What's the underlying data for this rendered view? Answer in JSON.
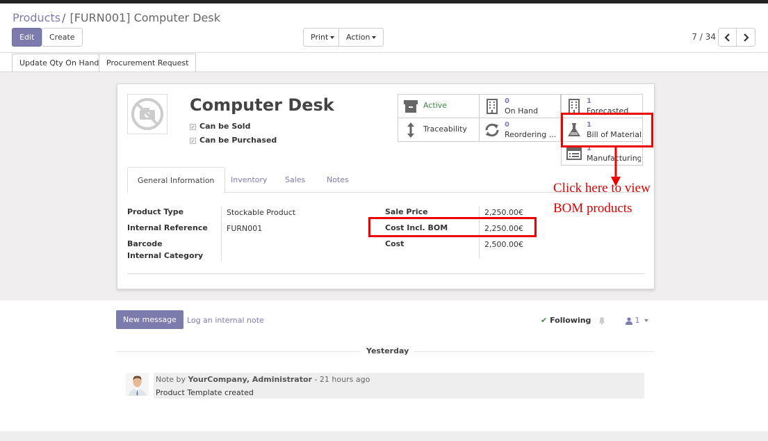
{
  "breadcrumb": {
    "parent": "Products",
    "separator": "/",
    "current": "[FURN001] Computer Desk"
  },
  "toolbar": {
    "edit": "Edit",
    "create": "Create",
    "print": "Print",
    "action": "Action"
  },
  "pager": {
    "value": "7 / 34"
  },
  "statusbar": {
    "update_qty": "Update Qty On Hand",
    "procurement": "Procurement Request"
  },
  "product": {
    "name": "Computer Desk",
    "can_be_sold": "Can be Sold",
    "can_be_purchased": "Can be Purchased"
  },
  "smart_buttons": {
    "active": "Active",
    "on_hand": {
      "value": "0",
      "label": "On Hand"
    },
    "forecasted": {
      "value": "1",
      "label": "Forecasted"
    },
    "traceability": "Traceability",
    "reordering": {
      "value": "0",
      "label": "Reordering ..."
    },
    "bom": {
      "value": "1",
      "label": "Bill of Materials"
    },
    "manufacturing": {
      "value": "1",
      "label": "Manufacturing"
    }
  },
  "tabs": [
    "General Information",
    "Inventory",
    "Sales",
    "Notes"
  ],
  "general": {
    "product_type_label": "Product Type",
    "product_type": "Stockable Product",
    "internal_ref_label": "Internal Reference",
    "internal_ref": "FURN001",
    "barcode_label": "Barcode",
    "internal_category_label": "Internal Category",
    "sale_price_label": "Sale Price",
    "sale_price": "2,250.00€",
    "cost_bom_label": "Cost Incl. BOM",
    "cost_bom": "2,250.00€",
    "cost_label": "Cost",
    "cost": "2,500.00€"
  },
  "annotation": {
    "line1": "Click here to view",
    "line2": "BOM products"
  },
  "chatter": {
    "new_message": "New message",
    "log_note": "Log an internal note",
    "following": "Following",
    "followers": "1",
    "date_separator": "Yesterday",
    "message": {
      "prefix": "Note by",
      "author": "YourCompany, Administrator",
      "time": "- 21 hours ago",
      "body": "Product Template created"
    }
  },
  "colors": {
    "accent": "#7c7bad",
    "annotation": "#e00000",
    "active_green": "#3c8a3c"
  }
}
